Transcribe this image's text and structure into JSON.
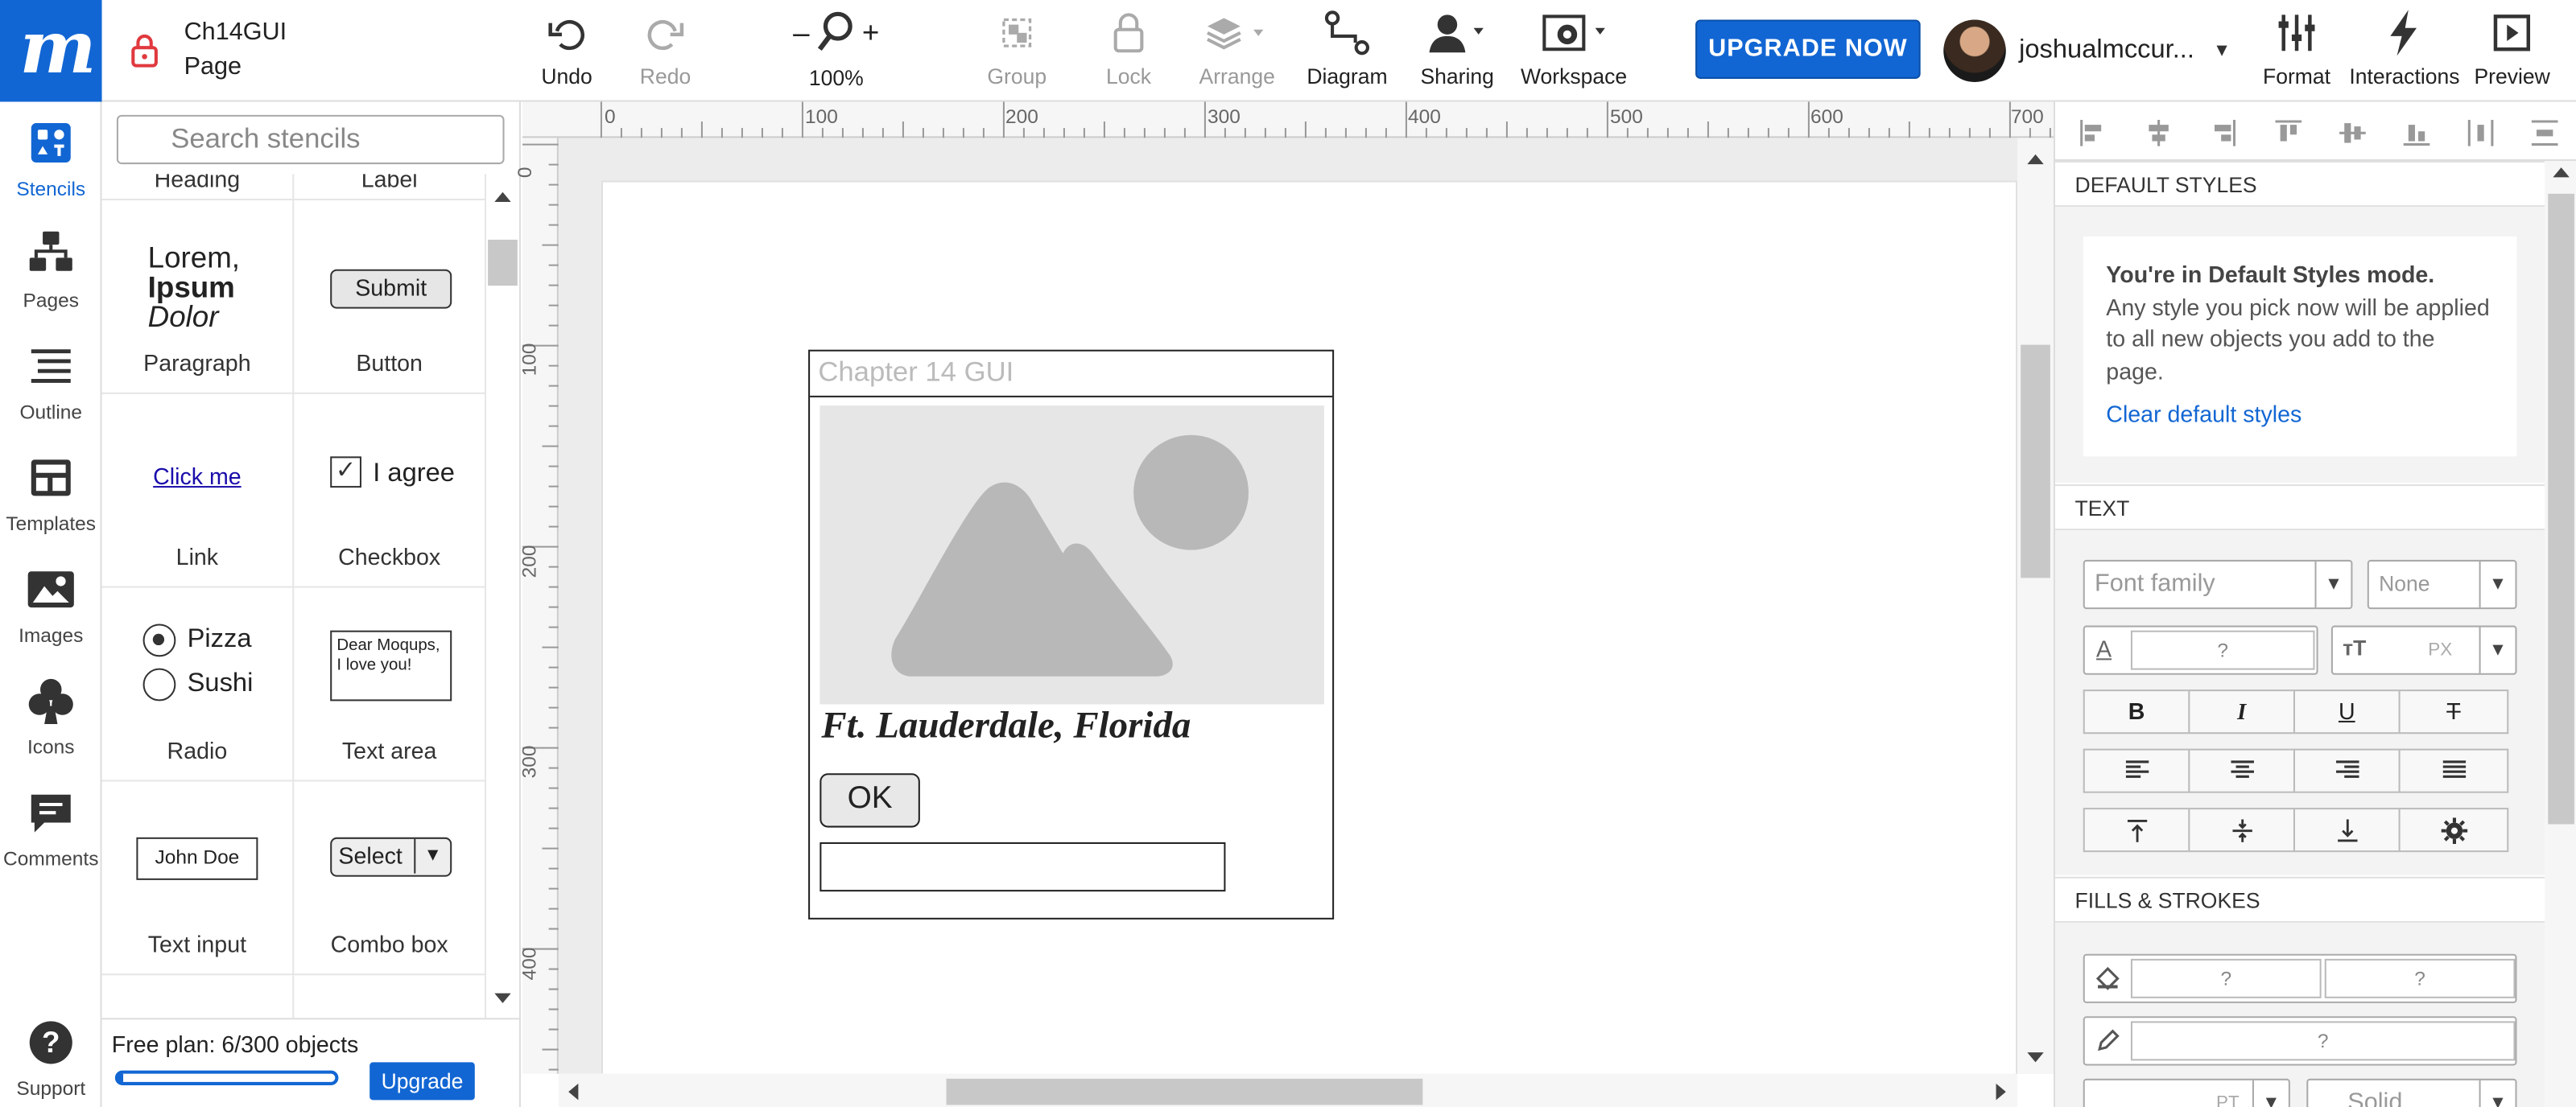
{
  "app": {
    "logo": "m",
    "doc_title": "Ch14GUI",
    "doc_page": "Page"
  },
  "toolbar": {
    "undo": "Undo",
    "redo": "Redo",
    "zoom": "100%",
    "zoom_minus": "–",
    "zoom_plus": "+",
    "group": "Group",
    "lock": "Lock",
    "arrange": "Arrange",
    "diagram": "Diagram",
    "sharing": "Sharing",
    "workspace": "Workspace",
    "upgrade": "UPGRADE NOW",
    "user": "joshualmccur...",
    "format": "Format",
    "interactions": "Interactions",
    "preview": "Preview"
  },
  "leftnav": {
    "stencils": "Stencils",
    "pages": "Pages",
    "outline": "Outline",
    "templates": "Templates",
    "images": "Images",
    "icons": "Icons",
    "comments": "Comments",
    "support": "Support"
  },
  "stencils": {
    "search_placeholder": "Search stencils",
    "top_labels": [
      "Heading",
      "Label"
    ],
    "paragraph": {
      "l1": "Lorem,",
      "l2": "Ipsum",
      "l3": "Dolor",
      "name": "Paragraph"
    },
    "button": {
      "text": "Submit",
      "name": "Button"
    },
    "link": {
      "text": "Click me",
      "name": "Link"
    },
    "checkbox": {
      "text": "I agree",
      "name": "Checkbox"
    },
    "radio": {
      "a": "Pizza",
      "b": "Sushi",
      "name": "Radio"
    },
    "textarea": {
      "text": "Dear Moqups, I love you!",
      "name": "Text area"
    },
    "textinput": {
      "text": "John Doe",
      "name": "Text input"
    },
    "combobox": {
      "text": "Select",
      "name": "Combo box"
    }
  },
  "plan": {
    "text": "Free plan: 6/300 objects",
    "button": "Upgrade",
    "progress": 0.02
  },
  "ruler": {
    "top": [
      "0",
      "100",
      "200",
      "300",
      "400",
      "500",
      "600",
      "700"
    ],
    "left": [
      "0",
      "100",
      "200",
      "300",
      "400"
    ]
  },
  "wireframe": {
    "title": "Chapter 14 GUI",
    "city": "Ft. Lauderdale, Florida",
    "ok": "OK"
  },
  "rightpanel": {
    "default_styles": "DEFAULT STYLES",
    "info_title": "You're in Default Styles mode.",
    "info_body": "Any style you pick now will be applied to all new objects you add to the page.",
    "info_link": "Clear default styles",
    "text": "TEXT",
    "font_family": "Font family",
    "font_weight": "None",
    "color_value": "?",
    "size_value": "PX",
    "fills": "FILLS & STROKES",
    "fill_a": "?",
    "fill_b": "?",
    "stroke": "?",
    "stroke_unit": "PT",
    "stroke_style": "Solid"
  },
  "colors": {
    "brand": "#1266d3"
  }
}
